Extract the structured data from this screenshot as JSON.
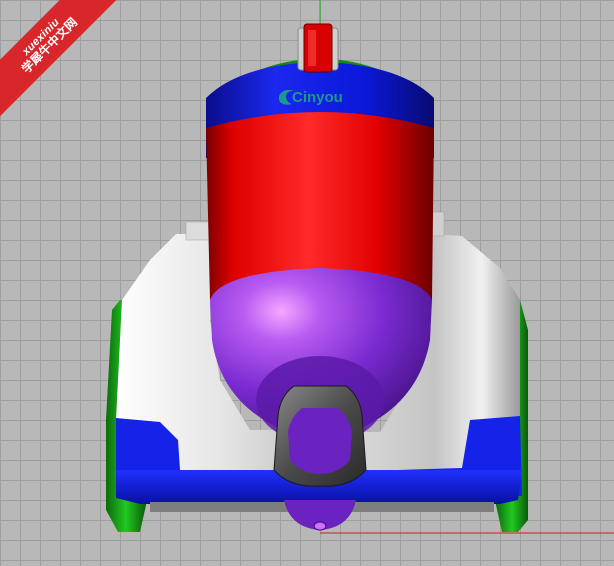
{
  "viewport": {
    "background": "#b8b8b8",
    "grid_color": "#9e9e9e"
  },
  "watermark": {
    "line1": "xuexiniu",
    "line2": "学犀牛中文网",
    "color": "#d8262b"
  },
  "model": {
    "brand_text": "Cinyou",
    "colors": {
      "body_red": "#e00000",
      "cap_blue": "#0a18d8",
      "purple": "#7a2ad0",
      "shell_white": "#e6e6e6",
      "wheel_green": "#18b418",
      "logo_teal": "#1a9a88",
      "handle_grey": "#555555"
    }
  },
  "axes": {
    "x_axis_color": "#c82020",
    "y_axis_color": "#1fb51f"
  }
}
